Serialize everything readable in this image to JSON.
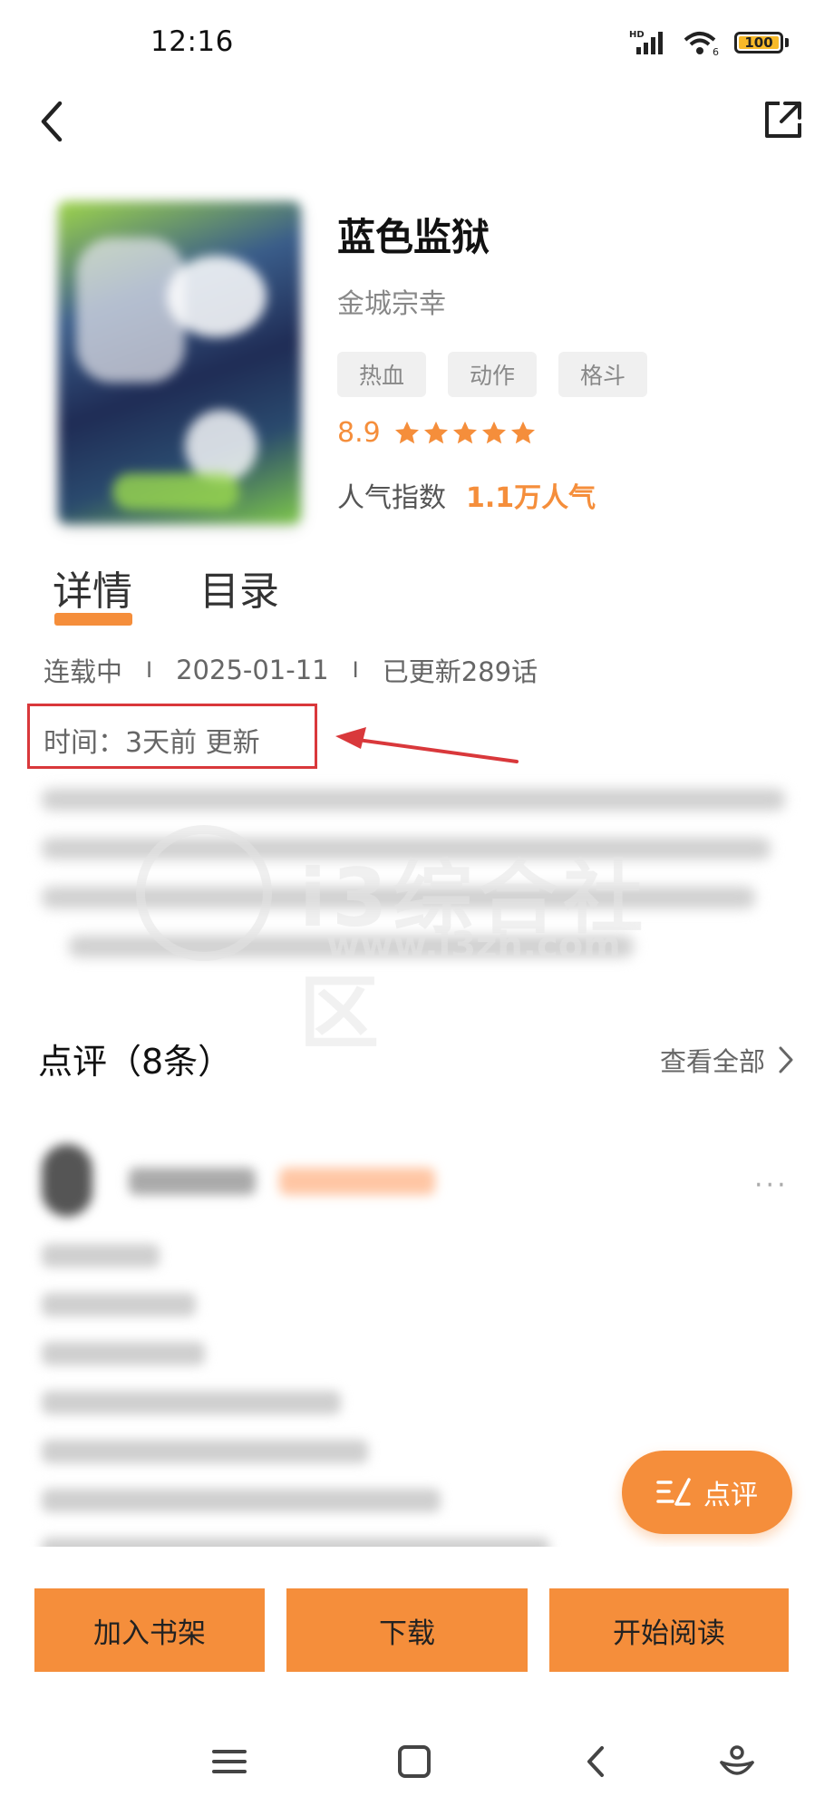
{
  "status_bar": {
    "time": "12:16",
    "network": "HD",
    "wifi_label": "6",
    "battery": "100",
    "battery_color": "#f7b928"
  },
  "book": {
    "title": "蓝色监狱",
    "author": "金城宗幸",
    "tags": [
      "热血",
      "动作",
      "格斗"
    ],
    "rating": "8.9",
    "stars": 5,
    "popularity_label": "人气指数",
    "popularity_value": "1.1万人气"
  },
  "tabs": [
    {
      "label": "详情",
      "active": true
    },
    {
      "label": "目录",
      "active": false
    }
  ],
  "meta": {
    "status": "连载中",
    "separator": "I",
    "date": "2025-01-11",
    "episodes": "已更新289话",
    "update_time": "时间：3天前 更新"
  },
  "watermark": {
    "text": "i3综合社区",
    "url": "www.i3zh.com"
  },
  "reviews": {
    "title": "点评（8条）",
    "view_all": "查看全部"
  },
  "fab": {
    "label": "点评"
  },
  "actions": {
    "add_shelf": "加入书架",
    "download": "下载",
    "start_reading": "开始阅读"
  },
  "colors": {
    "accent": "#f58e3b",
    "highlight_box": "#d9383b"
  }
}
